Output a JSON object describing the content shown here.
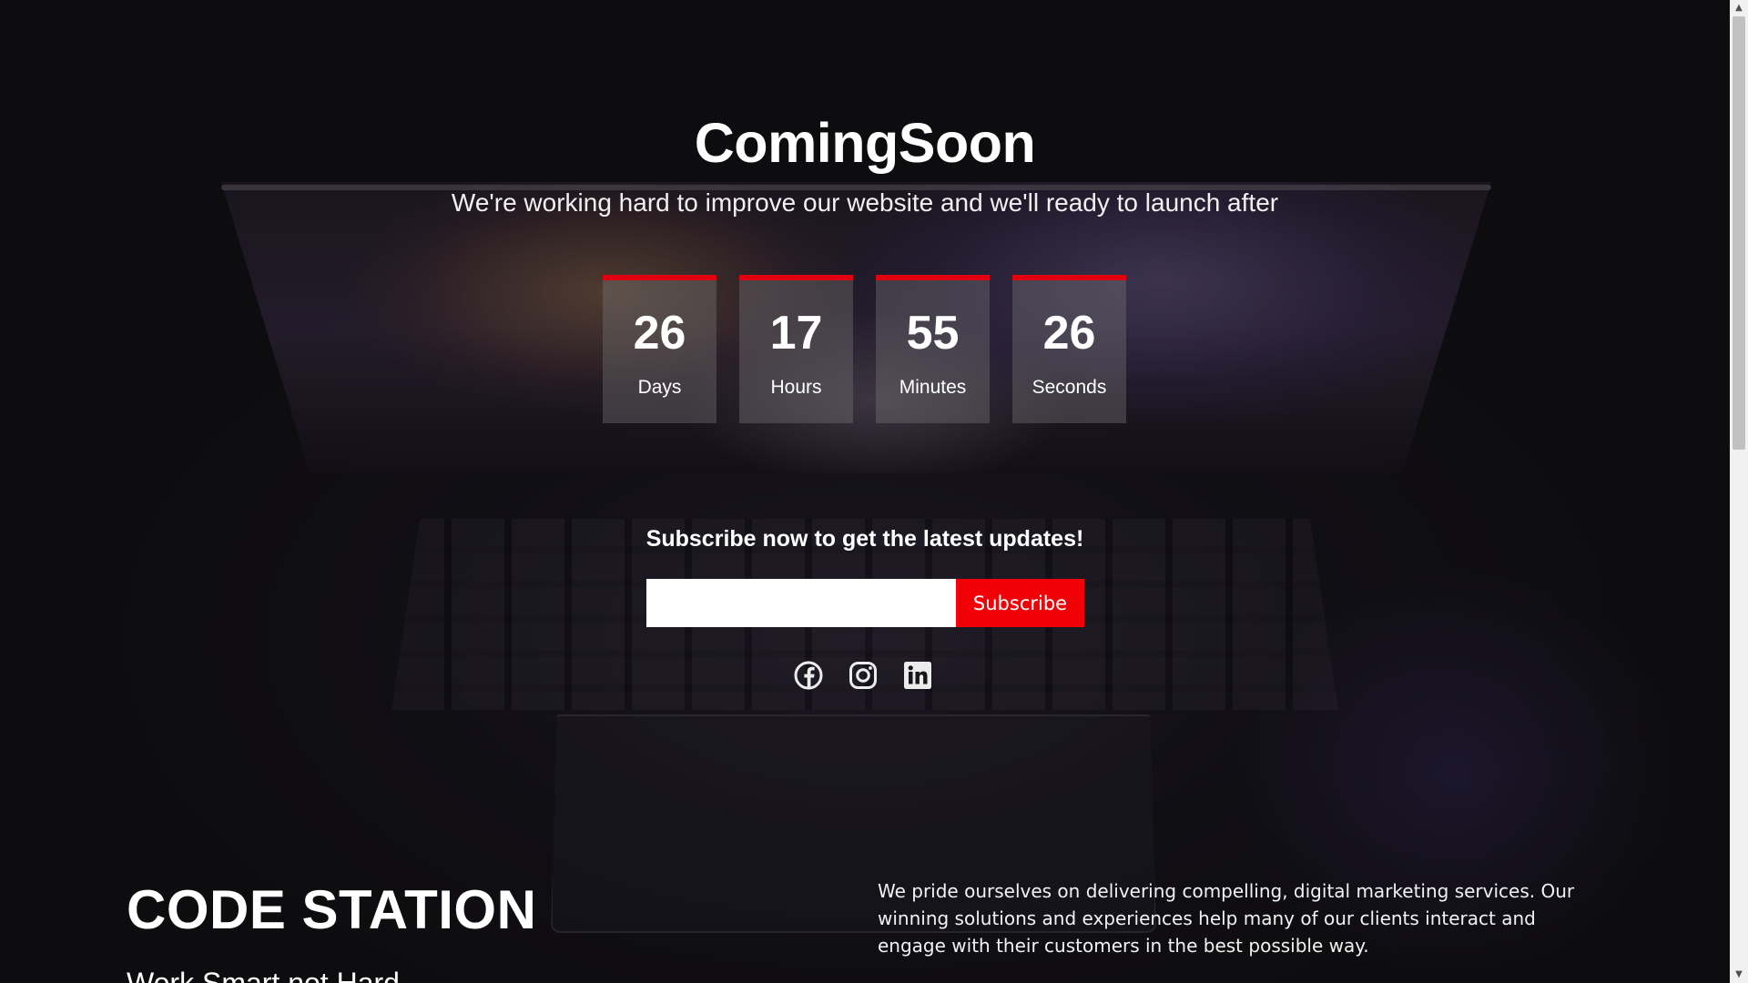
{
  "header": {
    "title": "ComingSoon",
    "subtitle": "We're working hard to improve our website and we'll ready to launch after"
  },
  "countdown": [
    {
      "value": "26",
      "label": "Days"
    },
    {
      "value": "17",
      "label": "Hours"
    },
    {
      "value": "55",
      "label": "Minutes"
    },
    {
      "value": "26",
      "label": "Seconds"
    }
  ],
  "subscribe": {
    "heading": "Subscribe now to get the latest updates!",
    "email_value": "",
    "email_placeholder": "",
    "button_label": "Subscribe"
  },
  "social": [
    "facebook-icon",
    "instagram-icon",
    "linkedin-icon"
  ],
  "footer": {
    "brand": "CODE STATION",
    "tagline": "Work Smart not Hard",
    "about": "We pride ourselves on delivering compelling, digital marketing services. Our winning solutions and experiences help many of our clients interact and engage with their customers in the best possible way."
  },
  "colors": {
    "accent": "#e10010",
    "button": "#f20008",
    "background": "#161517"
  }
}
